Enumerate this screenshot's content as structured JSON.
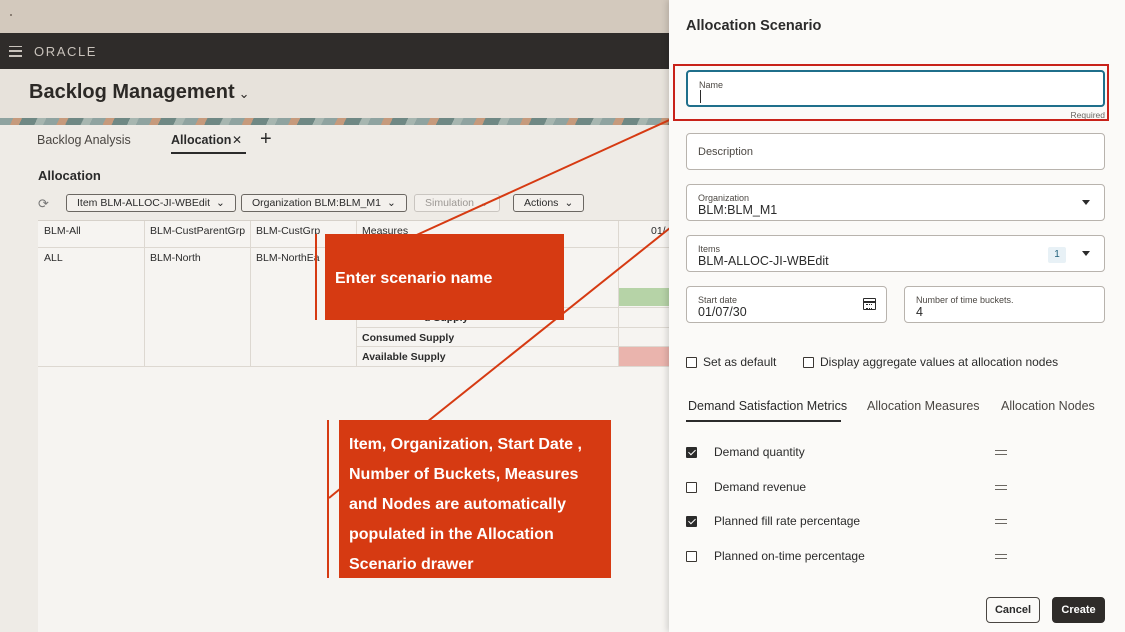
{
  "app": {
    "brand": "ORACLE",
    "page_title": "Backlog Management"
  },
  "tabs": [
    {
      "label": "Backlog Analysis"
    },
    {
      "label": "Allocation"
    }
  ],
  "section_title": "Allocation",
  "toolbar": {
    "item_filter": "Item BLM-ALLOC-JI-WBEdit",
    "org_filter": "Organization BLM:BLM_M1",
    "simulation": "Simulation",
    "actions": "Actions"
  },
  "grid": {
    "headers": [
      "BLM-All",
      "BLM-CustParentGrp",
      "BLM-CustGrp",
      "Measures",
      "01/"
    ],
    "row": [
      "ALL",
      "BLM-North",
      "BLM-NorthEa"
    ],
    "measures": [
      "Consumed Supply",
      "Available Supply"
    ],
    "partial_measure": "d Supply"
  },
  "callouts": {
    "first": "Enter scenario name",
    "second": "Item, Organization, Start Date , Number of Buckets, Measures and Nodes are automatically populated in the Allocation Scenario drawer"
  },
  "drawer": {
    "title": "Allocation Scenario",
    "name": {
      "label": "Name",
      "value": "",
      "required": "Required"
    },
    "description": {
      "placeholder": "Description"
    },
    "organization": {
      "label": "Organization",
      "value": "BLM:BLM_M1"
    },
    "items": {
      "label": "Items",
      "value": "BLM-ALLOC-JI-WBEdit",
      "count": "1"
    },
    "start_date": {
      "label": "Start date",
      "value": "01/07/30"
    },
    "buckets": {
      "label": "Number of time buckets.",
      "value": "4"
    },
    "set_default": {
      "label": "Set as default",
      "checked": false
    },
    "aggregate": {
      "label": "Display aggregate values at allocation nodes",
      "checked": false
    },
    "tabs": [
      "Demand Satisfaction Metrics",
      "Allocation Measures",
      "Allocation Nodes"
    ],
    "metrics": [
      {
        "label": "Demand quantity",
        "checked": true
      },
      {
        "label": "Demand revenue",
        "checked": false
      },
      {
        "label": "Planned fill rate percentage",
        "checked": true
      },
      {
        "label": "Planned on-time percentage",
        "checked": false
      }
    ],
    "buttons": {
      "cancel": "Cancel",
      "create": "Create"
    }
  },
  "colors": {
    "callout": "#d63a12",
    "highlight": "#c8221a",
    "focus": "#1f6f8b"
  }
}
